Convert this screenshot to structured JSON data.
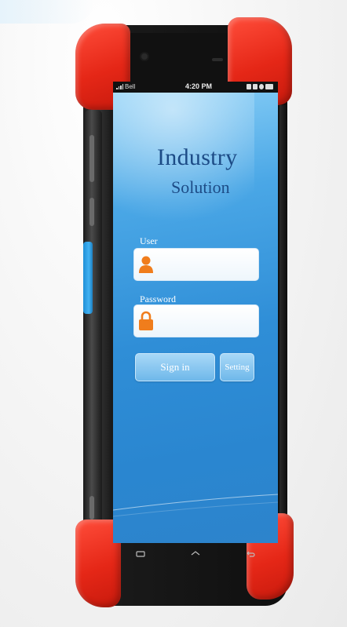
{
  "status_bar": {
    "carrier": "Bell",
    "time": "4:20 PM"
  },
  "app": {
    "title_line1": "Industry",
    "title_line2": "Solution"
  },
  "login": {
    "user_label": "User",
    "user_value": "",
    "password_label": "Password",
    "password_value": "",
    "sign_in_label": "Sign in",
    "setting_label": "Setting"
  },
  "icons": {
    "user_field": "person-icon",
    "password_field": "padlock-icon",
    "nav": [
      "recent-apps-icon",
      "home-icon",
      "back-icon"
    ]
  },
  "colors": {
    "bumper": "#e52717",
    "screen_blue": "#2f8ed7",
    "field_icon_orange": "#f07d1c",
    "title_navy": "#1c4b86",
    "side_key_blue": "#42b2f2"
  }
}
